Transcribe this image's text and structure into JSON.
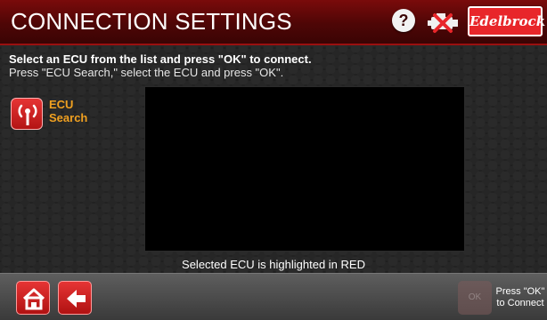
{
  "header": {
    "title": "CONNECTION SETTINGS",
    "help_label": "?",
    "brand_logo_text": "Edelbrock"
  },
  "instructions": {
    "line1": "Select an ECU from the list and press \"OK\" to connect.",
    "line2": "Press \"ECU Search,\" select the ECU and press \"OK\"."
  },
  "ecu_search": {
    "label_line1": "ECU",
    "label_line2": "Search"
  },
  "ecu_list": {
    "items": []
  },
  "hint": "Selected ECU is highlighted in RED",
  "footer": {
    "ok_button_text": "OK",
    "ok_label_line1": "Press \"OK\"",
    "ok_label_line2": "to Connect"
  },
  "colors": {
    "header_red": "#4e0606",
    "accent_red": "#e63434",
    "label_orange": "#f0a020"
  },
  "icons": [
    "help-icon",
    "engine-disconnected-icon",
    "antenna-icon",
    "home-icon",
    "back-arrow-icon"
  ]
}
